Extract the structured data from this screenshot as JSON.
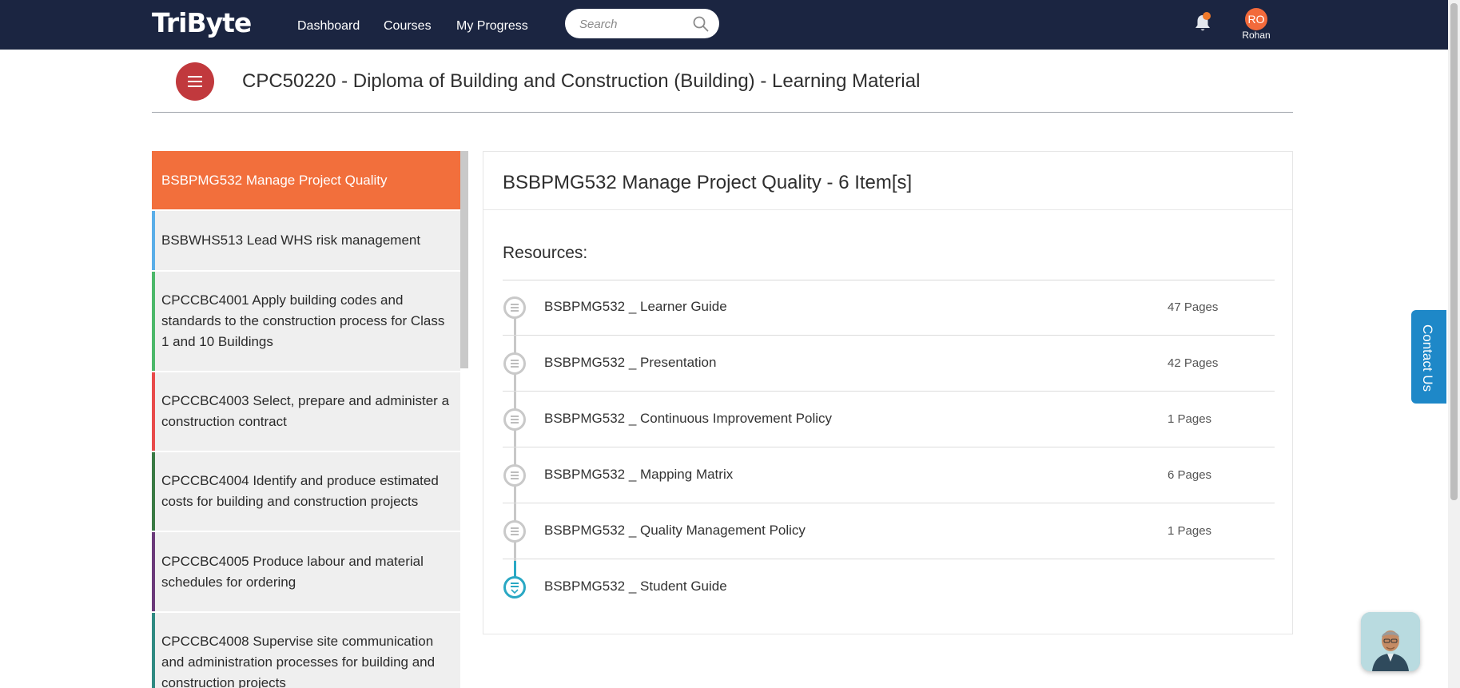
{
  "navbar": {
    "logo": "TriByte",
    "links": [
      "Dashboard",
      "Courses",
      "My Progress"
    ],
    "search_placeholder": "Search",
    "user_initials": "RO",
    "user_name": "Rohan"
  },
  "header": {
    "title": "CPC50220 - Diploma of Building and Construction (Building) - Learning Material"
  },
  "sidebar": {
    "items": [
      {
        "label": "BSBPMG532 Manage Project Quality",
        "accent": "#f26f3c",
        "active": true
      },
      {
        "label": "BSBWHS513 Lead WHS risk management",
        "accent": "#5aaee8"
      },
      {
        "label": "CPCCBC4001 Apply building codes and standards to the construction process for Class 1 and 10 Buildings",
        "accent": "#4cb86a"
      },
      {
        "label": "CPCCBC4003 Select, prepare and administer a construction contract",
        "accent": "#e84a4a"
      },
      {
        "label": "CPCCBC4004 Identify and produce estimated costs for building and construction projects",
        "accent": "#3a7a44"
      },
      {
        "label": "CPCCBC4005 Produce labour and material schedules for ordering",
        "accent": "#6b3a7a"
      },
      {
        "label": "CPCCBC4008 Supervise site communication and administration processes for building and construction projects",
        "accent": "#2f8a82"
      }
    ]
  },
  "panel": {
    "title": "BSBPMG532 Manage Project Quality - 6 Item[s]",
    "resources_label": "Resources:",
    "resources": [
      {
        "name": "BSBPMG532 _ Learner Guide",
        "pages": "47 Pages"
      },
      {
        "name": "BSBPMG532 _ Presentation",
        "pages": "42 Pages"
      },
      {
        "name": "BSBPMG532 _ Continuous Improvement Policy",
        "pages": "1 Pages"
      },
      {
        "name": "BSBPMG532 _ Mapping Matrix",
        "pages": "6 Pages"
      },
      {
        "name": "BSBPMG532 _ Quality Management Policy",
        "pages": "1 Pages"
      },
      {
        "name": "BSBPMG532 _ Student Guide",
        "pages": ""
      }
    ]
  },
  "contact": {
    "label": "Contact Us"
  },
  "colors": {
    "navbar": "#1b2541",
    "active_orange": "#f26f3c",
    "menu_button": "#c1393d",
    "contact_blue": "#1e88c8",
    "timeline_active": "#2aa8c4"
  }
}
